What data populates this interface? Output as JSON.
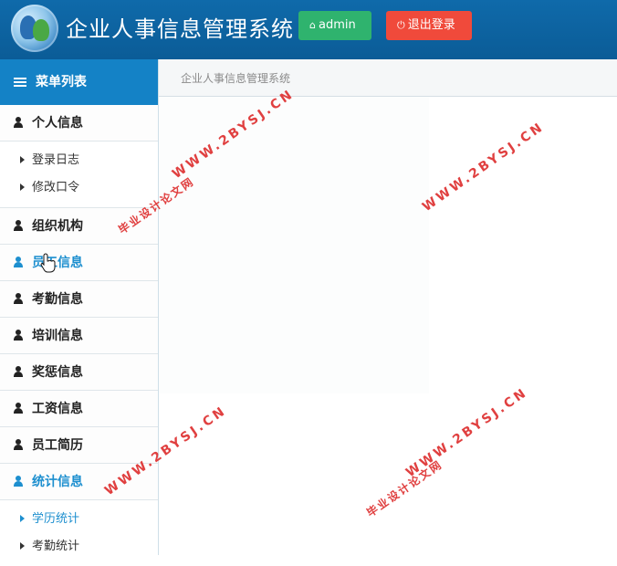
{
  "header": {
    "title": "企业人事信息管理系统",
    "admin_label": "admin",
    "logout_label": "退出登录",
    "colors": {
      "bar": "#0f6aaa",
      "admin_btn": "#2fb36e",
      "logout_btn": "#f04a3b"
    }
  },
  "sidebar": {
    "menu_title": "菜单列表",
    "sections": [
      {
        "label": "个人信息",
        "subs": [
          "登录日志",
          "修改口令"
        ]
      },
      {
        "label": "组织机构"
      },
      {
        "label": "员工信息"
      },
      {
        "label": "考勤信息"
      },
      {
        "label": "培训信息"
      },
      {
        "label": "奖惩信息"
      },
      {
        "label": "工资信息"
      },
      {
        "label": "员工简历"
      },
      {
        "label": "统计信息",
        "subs": [
          "学历统计",
          "考勤统计"
        ]
      }
    ],
    "accent_color": "#1d8fcf"
  },
  "breadcrumb": "企业人事信息管理系统",
  "watermarks": {
    "site": "WWW.2BYSJ.CN",
    "cn": "毕业设计论文网"
  }
}
